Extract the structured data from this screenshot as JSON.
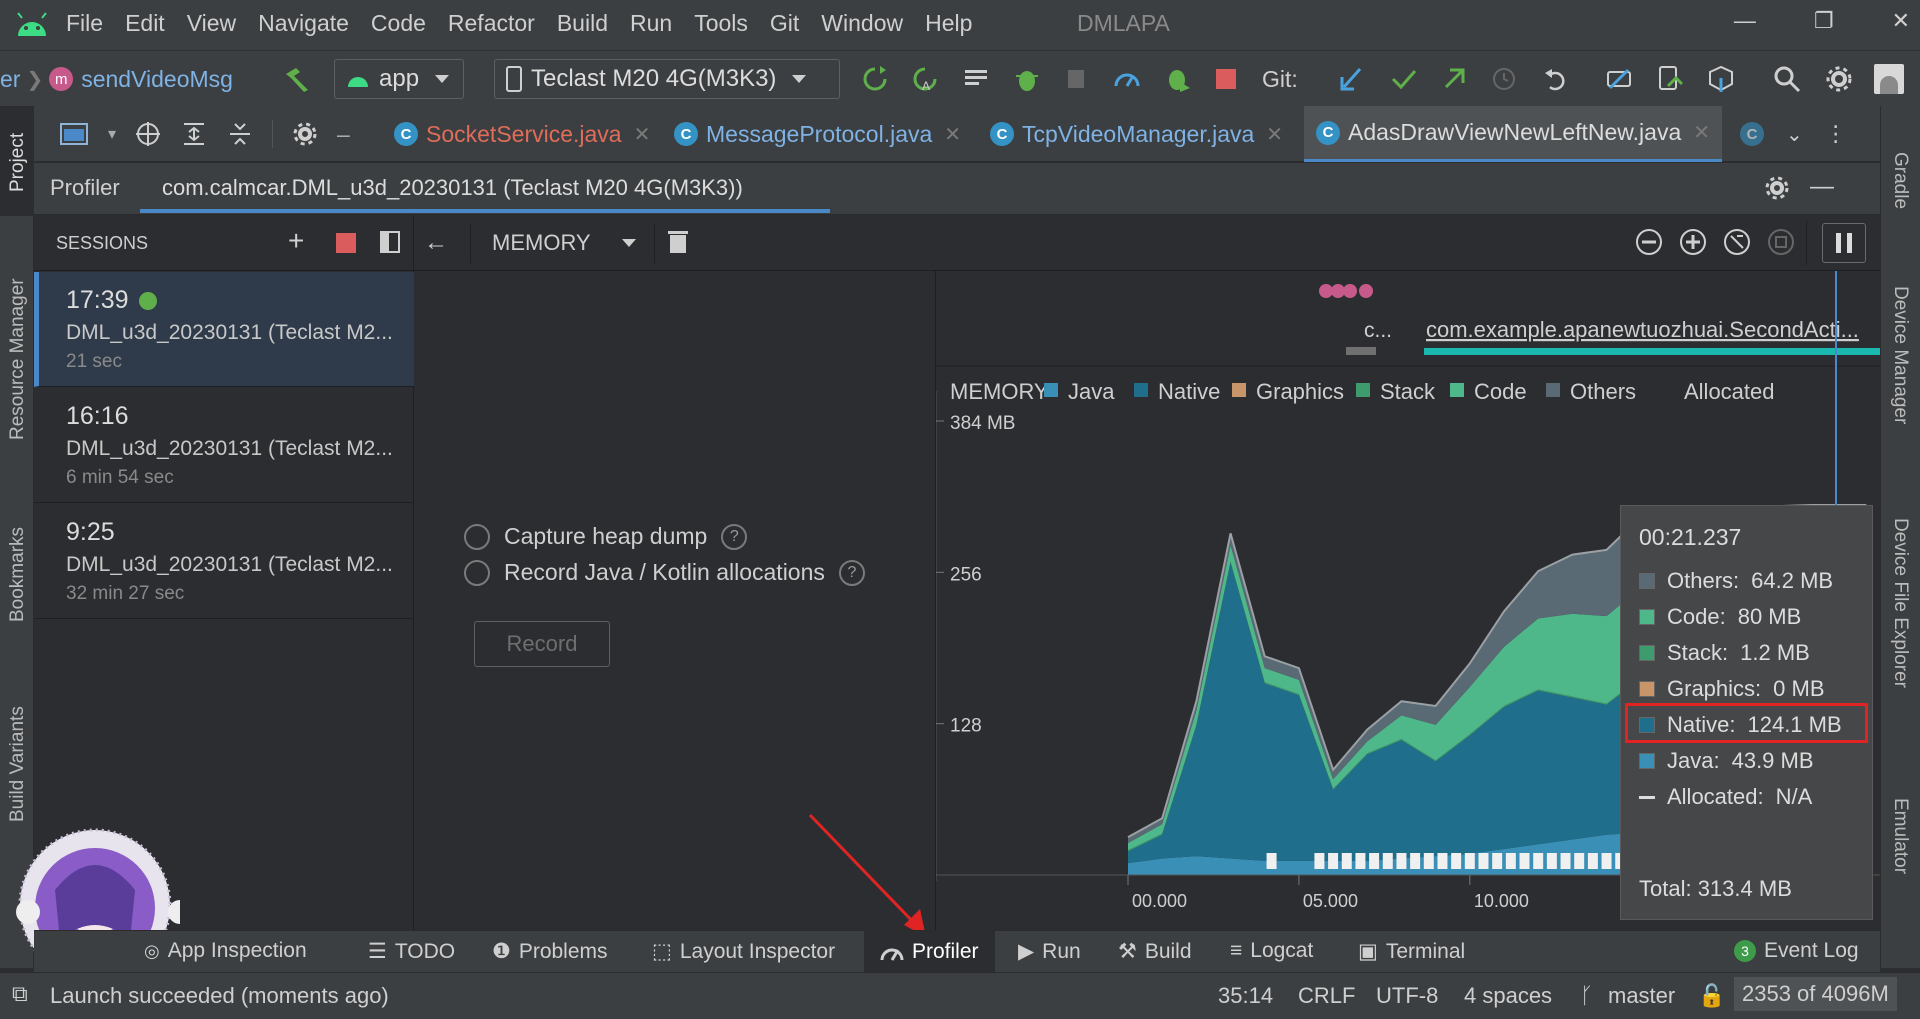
{
  "menubar": {
    "items": [
      "File",
      "Edit",
      "View",
      "Navigate",
      "Code",
      "Refactor",
      "Build",
      "Run",
      "Tools",
      "Git",
      "Window",
      "Help"
    ],
    "project": "DMLAPA",
    "win_min": "—",
    "win_restore": "❐",
    "win_close": "✕"
  },
  "toolbar": {
    "breadcrumb_prefix": "er",
    "breadcrumb_method": "sendVideoMsg",
    "run_config": "app",
    "device": "Teclast M20 4G(M3K3)",
    "git_label": "Git:"
  },
  "tabs": [
    {
      "label": "SocketService.java",
      "color": "#e06c5a"
    },
    {
      "label": "MessageProtocol.java",
      "color": "#7fb2e5"
    },
    {
      "label": "TcpVideoManager.java",
      "color": "#7fb2e5"
    },
    {
      "label": "AdasDrawViewNewLeftNew.java",
      "color": "#dcdcdc"
    }
  ],
  "profiler": {
    "title": "Profiler",
    "session_name": "com.calmcar.DML_u3d_20230131 (Teclast M20 4G(M3K3))",
    "sessions_label": "SESSIONS",
    "memory_label": "MEMORY",
    "sessions": [
      {
        "time": "17:39",
        "name": "DML_u3d_20230131 (Teclast M2...",
        "duration": "21 sec",
        "live": true
      },
      {
        "time": "16:16",
        "name": "DML_u3d_20230131 (Teclast M2...",
        "duration": "6 min 54 sec",
        "live": false
      },
      {
        "time": "9:25",
        "name": "DML_u3d_20230131 (Teclast M2...",
        "duration": "32 min 27 sec",
        "live": false
      }
    ],
    "options": [
      "Capture heap dump",
      "Record Java / Kotlin allocations"
    ],
    "record_button": "Record",
    "activity_short": "c...",
    "activity": "com.example.apanewtuozhuai.SecondActi..."
  },
  "chart_data": {
    "type": "area",
    "title": "MEMORY",
    "legend": [
      "Java",
      "Native",
      "Graphics",
      "Stack",
      "Code",
      "Others",
      "Allocated"
    ],
    "legend_colors": {
      "Java": "#3a8fb7",
      "Native": "#1f6e8c",
      "Graphics": "#c8956a",
      "Stack": "#3d9b6e",
      "Code": "#4fb88a",
      "Others": "#5a6a74",
      "Allocated": "#ffffff"
    },
    "y_ticks": [
      "384 MB",
      "256",
      "128"
    ],
    "x_ticks": [
      "00.000",
      "05.000",
      "10.000"
    ],
    "ylim": [
      0,
      384
    ],
    "xlim": [
      0,
      22
    ],
    "x": [
      0,
      1,
      2,
      3,
      4,
      5,
      6,
      7,
      8,
      9,
      10,
      11,
      12,
      13,
      14,
      15,
      16,
      17,
      18,
      19,
      20,
      21,
      21.6
    ],
    "series": [
      {
        "name": "Java",
        "values": [
          10,
          14,
          16,
          14,
          12,
          12,
          12,
          12,
          14,
          16,
          18,
          22,
          26,
          30,
          34,
          36,
          38,
          40,
          42,
          43,
          44,
          44,
          44
        ]
      },
      {
        "name": "Native",
        "values": [
          10,
          20,
          110,
          250,
          150,
          140,
          60,
          90,
          100,
          80,
          100,
          120,
          130,
          120,
          110,
          130,
          125,
          124,
          124,
          124,
          124,
          124,
          124
        ]
      },
      {
        "name": "Stack",
        "values": [
          1,
          1,
          1,
          1,
          1,
          1,
          1,
          1,
          1,
          1,
          1,
          1,
          1,
          1,
          1,
          1,
          1,
          1,
          1,
          1,
          1,
          1,
          1
        ]
      },
      {
        "name": "Code",
        "values": [
          6,
          8,
          12,
          14,
          12,
          12,
          8,
          10,
          20,
          30,
          40,
          50,
          60,
          70,
          74,
          76,
          78,
          80,
          80,
          80,
          80,
          80,
          80
        ]
      },
      {
        "name": "Others",
        "values": [
          5,
          5,
          8,
          10,
          10,
          10,
          8,
          10,
          12,
          16,
          20,
          30,
          40,
          50,
          56,
          60,
          62,
          64,
          64,
          64,
          64,
          64,
          64
        ]
      }
    ],
    "tooltip": {
      "time": "00:21.237",
      "rows": [
        {
          "label": "Others:",
          "value": "64.2 MB",
          "color": "#5a6a74"
        },
        {
          "label": "Code:",
          "value": "80 MB",
          "color": "#4fb88a"
        },
        {
          "label": "Stack:",
          "value": "1.2 MB",
          "color": "#3d9b6e"
        },
        {
          "label": "Graphics:",
          "value": "0 MB",
          "color": "#c8956a"
        },
        {
          "label": "Native:",
          "value": "124.1 MB",
          "color": "#1f6e8c"
        },
        {
          "label": "Java:",
          "value": "43.9 MB",
          "color": "#3a8fb7"
        },
        {
          "label": "Allocated:",
          "value": "N/A",
          "color": "dash"
        }
      ],
      "total": "Total: 313.4 MB"
    }
  },
  "bottom_tools": [
    {
      "label": "App Inspection"
    },
    {
      "label": "TODO"
    },
    {
      "label": "Problems"
    },
    {
      "label": "Layout Inspector"
    },
    {
      "label": "Profiler"
    },
    {
      "label": "Run"
    },
    {
      "label": "Build"
    },
    {
      "label": "Logcat"
    },
    {
      "label": "Terminal"
    }
  ],
  "event_log": {
    "count": "3",
    "label": "Event Log"
  },
  "status": {
    "message": "Launch succeeded (moments ago)",
    "position": "35:14",
    "line_sep": "CRLF",
    "encoding": "UTF-8",
    "indent": "4 spaces",
    "branch": "master",
    "memory": "2353 of 4096M"
  },
  "side_tools": {
    "left": [
      "Project",
      "Resource Manager",
      "Bookmarks",
      "Build Variants"
    ],
    "right": [
      "Gradle",
      "Device Manager",
      "Device File Explorer",
      "Emulator"
    ]
  }
}
